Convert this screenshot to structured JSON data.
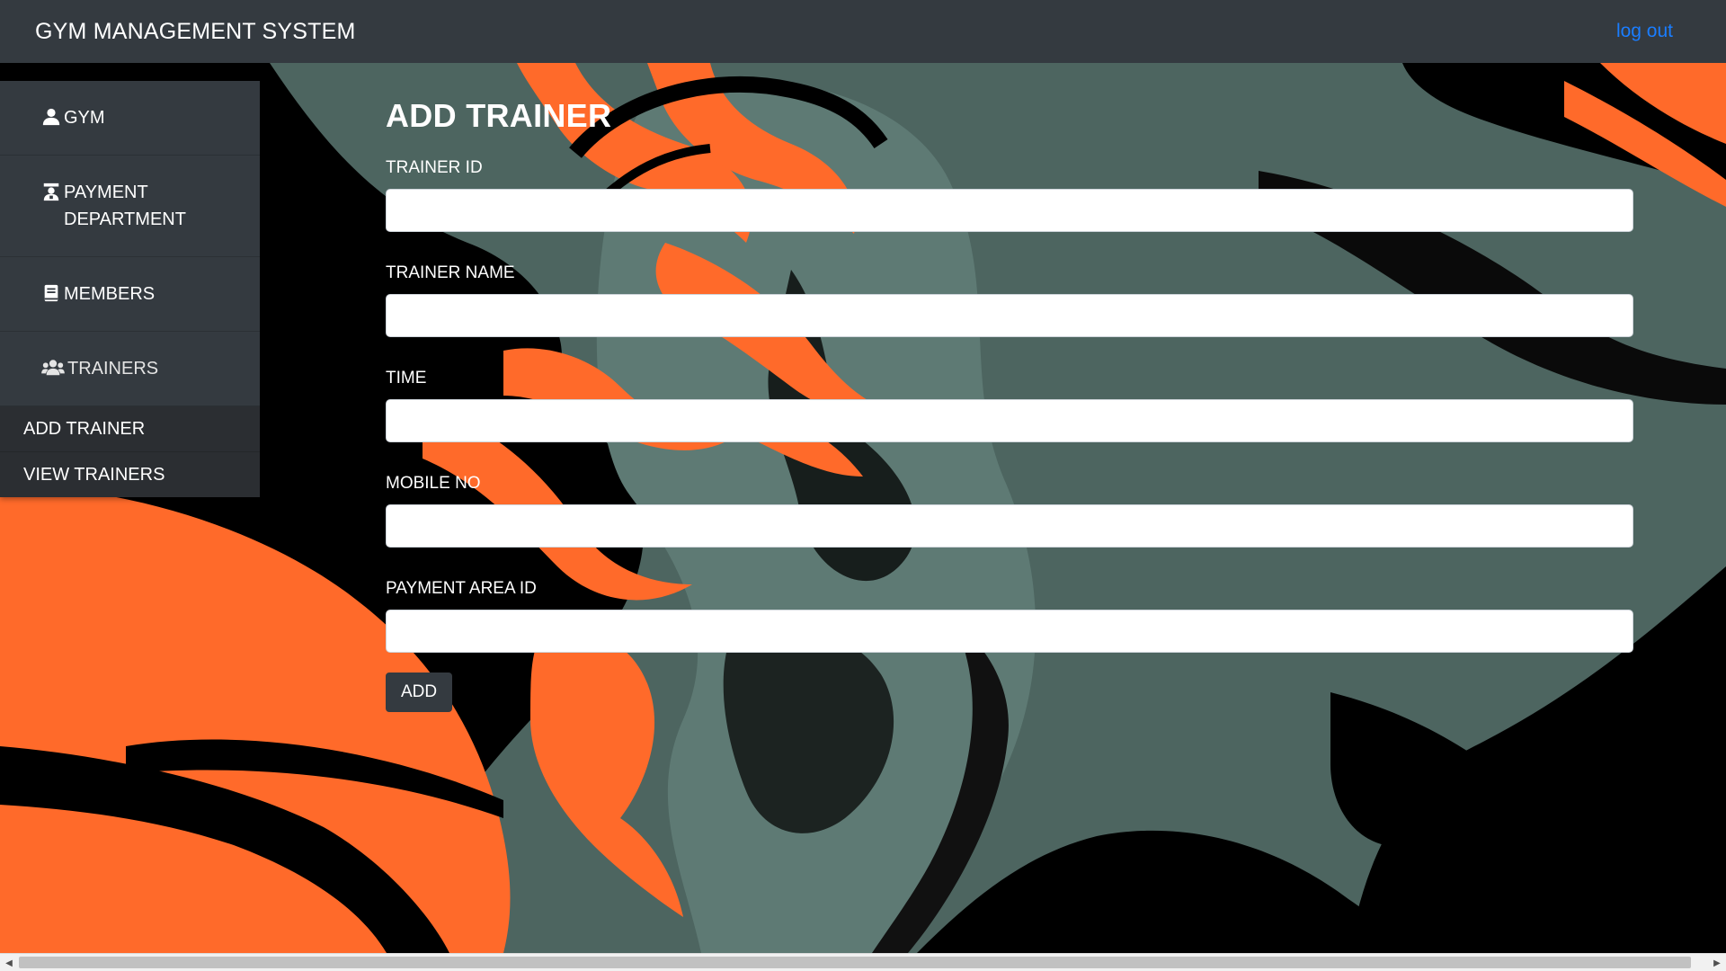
{
  "app": {
    "title": "GYM MANAGEMENT SYSTEM",
    "logout_label": "log out"
  },
  "sidebar": {
    "items": [
      {
        "label": "GYM",
        "icon": "user-icon"
      },
      {
        "label": "PAYMENT DEPARTMENT",
        "icon": "cashier-icon"
      },
      {
        "label": "MEMBERS",
        "icon": "book-icon"
      },
      {
        "label": "TRAINERS",
        "icon": "users-icon"
      }
    ],
    "submenu": [
      {
        "label": "ADD TRAINER"
      },
      {
        "label": "VIEW TRAINERS"
      }
    ]
  },
  "form": {
    "title": "ADD TRAINER",
    "fields": [
      {
        "label": "TRAINER ID",
        "value": ""
      },
      {
        "label": "TRAINER NAME",
        "value": ""
      },
      {
        "label": "TIME",
        "value": ""
      },
      {
        "label": "MOBILE NO",
        "value": ""
      },
      {
        "label": "PAYMENT AREA ID",
        "value": ""
      }
    ],
    "submit_label": "ADD"
  },
  "colors": {
    "navbar": "#343a40",
    "link": "#1a7dff",
    "background_slate": "#4d6560",
    "background_orange": "#ff6a2a",
    "background_black": "#000000"
  }
}
